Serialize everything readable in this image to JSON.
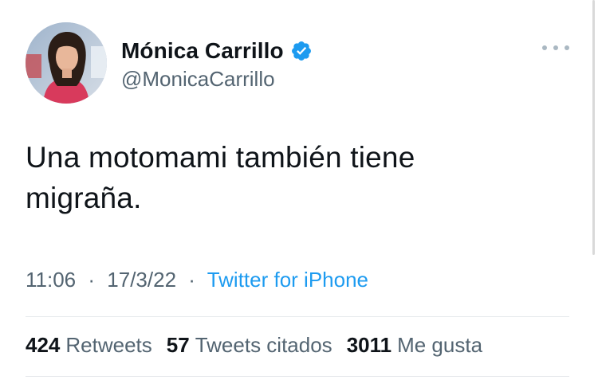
{
  "tweet": {
    "display_name": "Mónica Carrillo",
    "handle": "@MonicaCarrillo",
    "text_line1": "Una motomami también tiene",
    "text_line2": "migraña.",
    "time": "11:06",
    "date": "17/3/22",
    "separator": "·",
    "source": "Twitter for iPhone"
  },
  "stats": {
    "retweets_count": "424",
    "retweets_label": "Retweets",
    "quotes_count": "57",
    "quotes_label": "Tweets citados",
    "likes_count": "3011",
    "likes_label": "Me gusta"
  },
  "icons": {
    "verified": "verified-badge-icon",
    "more": "more-options-icon"
  },
  "colors": {
    "accent": "#1d9bf0",
    "secondary_text": "#536471",
    "primary_text": "#0f1419"
  }
}
